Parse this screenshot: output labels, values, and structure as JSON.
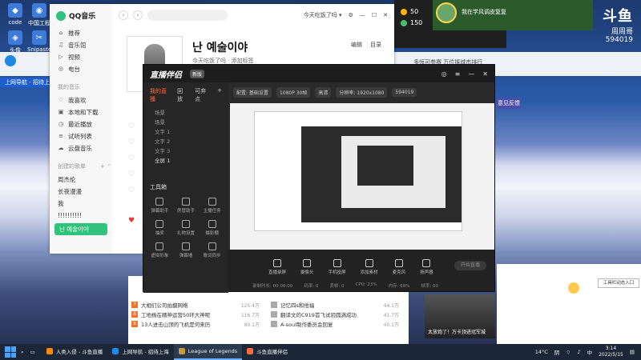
{
  "desktop": {
    "icons": [
      "code",
      "中国工程",
      "头像",
      "Snipaste",
      "卡拉OK"
    ]
  },
  "qqmusic": {
    "app_name": "QQ音乐",
    "nav": [
      {
        "icon": "home-icon",
        "label": "推荐"
      },
      {
        "icon": "music-hall-icon",
        "label": "音乐馆"
      },
      {
        "icon": "video-icon",
        "label": "视频"
      },
      {
        "icon": "radio-icon",
        "label": "电台"
      }
    ],
    "my_music_title": "我的音乐",
    "my_music": [
      {
        "icon": "heart-icon",
        "label": "我喜欢"
      },
      {
        "icon": "download-icon",
        "label": "本地和下载"
      },
      {
        "icon": "clock-icon",
        "label": "最近播放"
      },
      {
        "icon": "list-icon",
        "label": "试听列表"
      },
      {
        "icon": "cloud-icon",
        "label": "云盘音乐"
      }
    ],
    "created_title": "创建的歌单",
    "created": [
      "周杰伦",
      "长夜漫漫",
      "我",
      "!!!!!!!!!!"
    ],
    "active_playlist": "난 예술이야",
    "user_label": "今天吃饭了吗 ▾",
    "song_title": "난 예술이야",
    "song_meta": "今天吃饭了吗 · 添加标签",
    "edit_label": "编辑",
    "delete_label": "目录"
  },
  "top_right": {
    "gauge1": "50",
    "gauge2": "150",
    "streamer": "我在学风调皮复复",
    "brand": "斗鱼",
    "brand_sub": "周周哥",
    "room_id": "594019"
  },
  "browser": {
    "tab_blue": "上网导航 - 招待上海",
    "tab_purple": "意见反馈",
    "address": "多恒可参赛 万位振城市排行"
  },
  "live": {
    "title": "直播伴侣",
    "badge": "新版",
    "tabs": [
      "我的直播",
      "回放",
      "可弃点"
    ],
    "scene_items": [
      "场景",
      "场景",
      "文字 1",
      "文字 2",
      "文字 3",
      "全屏 1"
    ],
    "tools_title": "工具箱",
    "tools": [
      "弹幕助手",
      "房管助手",
      "主播任务",
      "抽奖",
      "礼物设置",
      "摄影棚",
      "虚拟形象",
      "弹幕墙",
      "歌词同步",
      "斗鱼直播",
      "开播",
      "美颜"
    ],
    "status_chips": [
      "配置: 基础设置",
      "1080P 30帧",
      "高清",
      "分辨率: 1920x1080",
      "594019"
    ],
    "bottom_icons": [
      "直播录屏",
      "摄像头",
      "手机投屏",
      "添加素材",
      "麦克风",
      "扬声器"
    ],
    "start_label": "开始直播",
    "status_row": [
      "录制时长: 00:00:00",
      "码率: 0",
      "丢帧: 0",
      "CPU: 23%",
      "内存: 68%",
      "帧率: 60"
    ]
  },
  "news": {
    "left": [
      {
        "n": "7",
        "text": "大相们公司拍摄网络",
        "val": "125.4万"
      },
      {
        "n": "8",
        "text": "工地杨在精神运营50环大神呢",
        "val": "116.7万"
      },
      {
        "n": "9",
        "text": "13人进击山顶的飞机是何来历",
        "val": "80.1万"
      }
    ],
    "right": [
      {
        "n": "",
        "text": "记忆四s和他福",
        "val": "44.1万"
      },
      {
        "n": "",
        "text": "翻译文的C919首飞试验圆满成功",
        "val": "41.7万"
      },
      {
        "n": "",
        "text": "A-soul制作委员会回复",
        "val": "40.1万"
      }
    ]
  },
  "video_caption": "太放炮了！万卡顶进冠军城",
  "bubble": "工具栏动态入口",
  "taskbar": {
    "apps": [
      "人类入侵 - 斗鱼直播",
      "上网导航 - 招待上海",
      "League of Legends",
      "斗鱼直播伴侣"
    ],
    "temp": "14°C",
    "weather": "阴",
    "time": "3:14",
    "date": "2022/5/15",
    "lang": "中"
  }
}
